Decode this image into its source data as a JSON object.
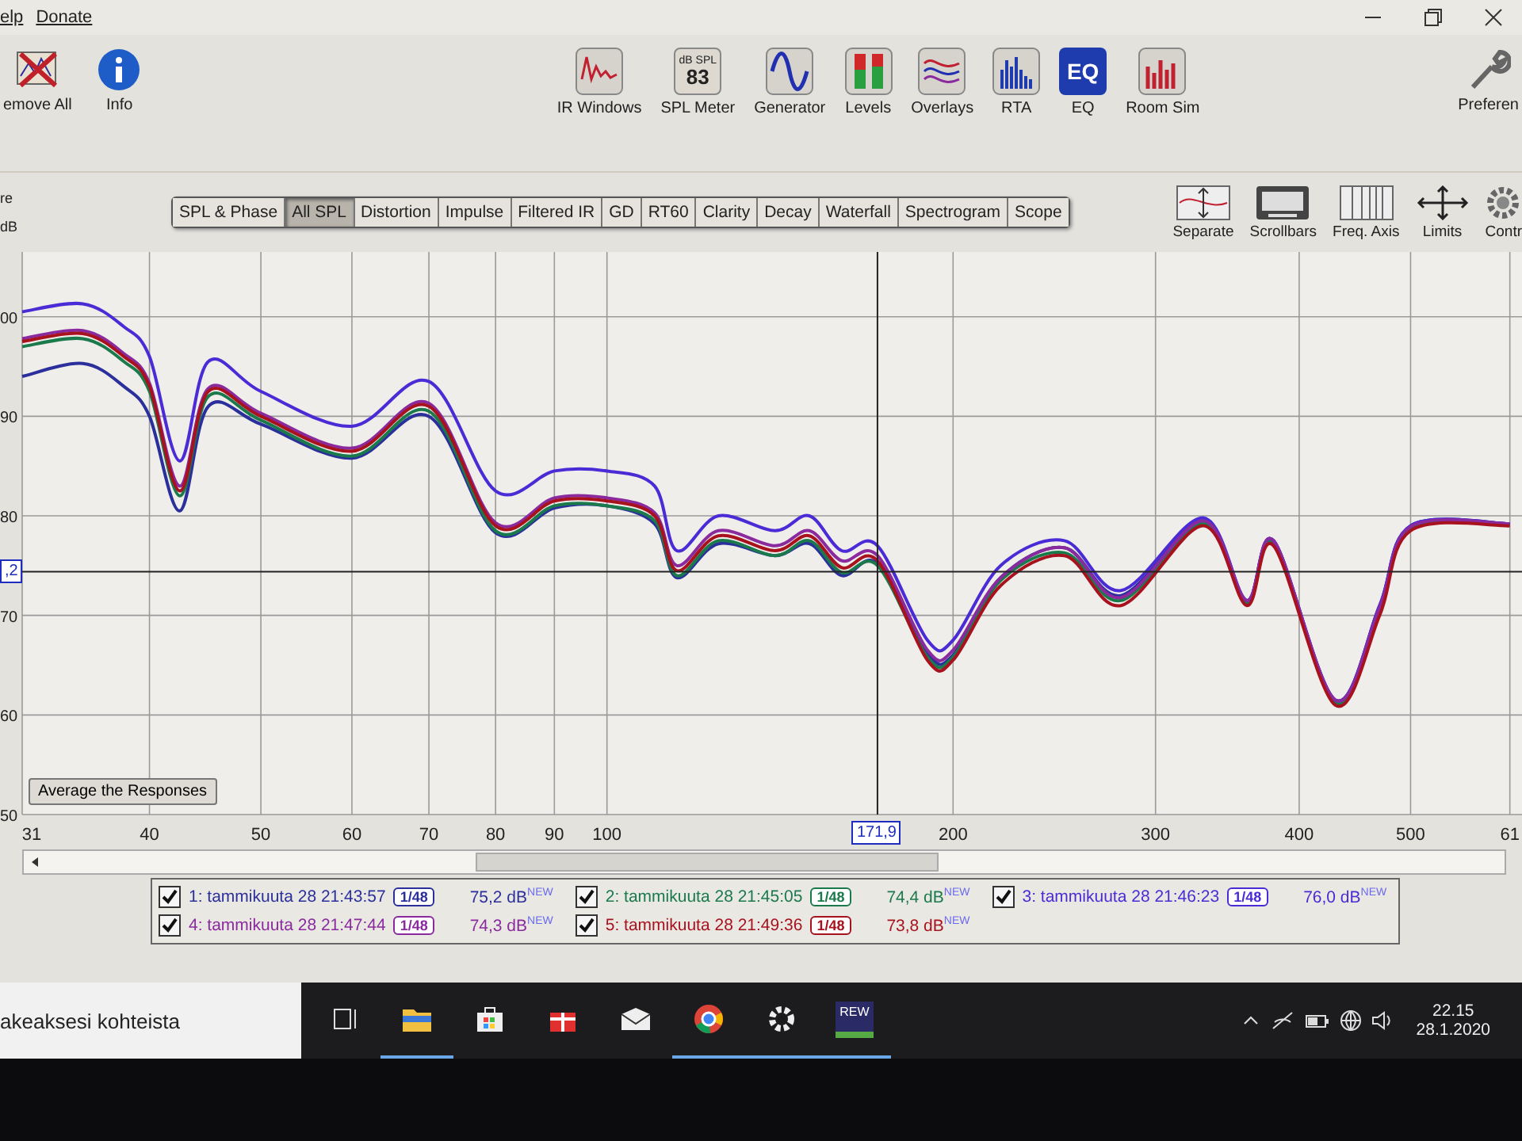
{
  "menu": [
    "elp",
    "Donate"
  ],
  "toolbar_left": [
    {
      "label": "emove All",
      "kind": "remove"
    },
    {
      "label": "Info",
      "kind": "info"
    }
  ],
  "toolbar_center": [
    {
      "label": "IR Windows",
      "kind": "ir"
    },
    {
      "label": "SPL Meter",
      "kind": "spl",
      "badge_top": "dB SPL",
      "badge_value": "83"
    },
    {
      "label": "Generator",
      "kind": "sine"
    },
    {
      "label": "Levels",
      "kind": "levels"
    },
    {
      "label": "Overlays",
      "kind": "overlays"
    },
    {
      "label": "RTA",
      "kind": "rta"
    },
    {
      "label": "EQ",
      "kind": "eq",
      "badge_value": "EQ"
    },
    {
      "label": "Room Sim",
      "kind": "roomsim"
    }
  ],
  "toolbar_right": {
    "label": "Preferen",
    "kind": "wrench"
  },
  "side_labels": [
    "re",
    "dB"
  ],
  "tabs": [
    {
      "label": "SPL & Phase",
      "selected": false
    },
    {
      "label": "All SPL",
      "selected": true
    },
    {
      "label": "Distortion",
      "selected": false
    },
    {
      "label": "Impulse",
      "selected": false
    },
    {
      "label": "Filtered IR",
      "selected": false
    },
    {
      "label": "GD",
      "selected": false
    },
    {
      "label": "RT60",
      "selected": false
    },
    {
      "label": "Clarity",
      "selected": false
    },
    {
      "label": "Decay",
      "selected": false
    },
    {
      "label": "Waterfall",
      "selected": false
    },
    {
      "label": "Spectrogram",
      "selected": false
    },
    {
      "label": "Scope",
      "selected": false
    }
  ],
  "graph_tools": [
    {
      "label": "Separate",
      "kind": "separate"
    },
    {
      "label": "Scrollbars",
      "kind": "scrollbars"
    },
    {
      "label": "Freq. Axis",
      "kind": "freqaxis"
    },
    {
      "label": "Limits",
      "kind": "limits"
    },
    {
      "label": "Contr",
      "kind": "controls"
    }
  ],
  "graph": {
    "average_button": "Average the Responses",
    "x_labels": [
      "31",
      "40",
      "50",
      "60",
      "70",
      "80",
      "90",
      "100",
      "200",
      "300",
      "400",
      "500",
      "61"
    ],
    "y_labels": [
      "00",
      "90",
      "80",
      "70",
      "60",
      "50"
    ],
    "cursor": {
      "frequency": "171,9",
      "level": ",2"
    }
  },
  "legend": [
    {
      "checked": true,
      "label": "1: tammikuuta 28 21:43:57",
      "color": "#2b2f9c",
      "smoothing": "1/48",
      "level": "75,2 dB$^{NEW}$"
    },
    {
      "checked": true,
      "label": "2: tammikuuta 28 21:45:05",
      "color": "#1b7a4c",
      "smoothing": "1/48",
      "level": "74,4 dB$^{NEW}$"
    },
    {
      "checked": true,
      "label": "3: tammikuuta 28 21:46:23",
      "color": "#4a2bd6",
      "smoothing": "1/48",
      "level": "76,0 dB$^{NEW}$"
    },
    {
      "checked": true,
      "label": "4: tammikuuta 28 21:47:44",
      "color": "#8a2a9e",
      "smoothing": "1/48",
      "level": "74,3 dB$^{NEW}$"
    },
    {
      "checked": true,
      "label": "5: tammikuuta 28 21:49:36",
      "color": "#a8121e",
      "smoothing": "1/48",
      "level": "73,8 dB$^{NEW}$"
    }
  ],
  "taskbar": {
    "search": "akeaksesi kohteista",
    "apps": [
      {
        "kind": "taskview",
        "active": false
      },
      {
        "kind": "folder",
        "active": true
      },
      {
        "kind": "store",
        "active": false
      },
      {
        "kind": "gift",
        "active": false
      },
      {
        "kind": "mail",
        "active": false
      },
      {
        "kind": "browser",
        "active": true
      },
      {
        "kind": "gear",
        "active": true
      },
      {
        "kind": "rew",
        "active": true,
        "label": "REW"
      }
    ],
    "time": "22.15",
    "date": "28.1.2020"
  }
}
